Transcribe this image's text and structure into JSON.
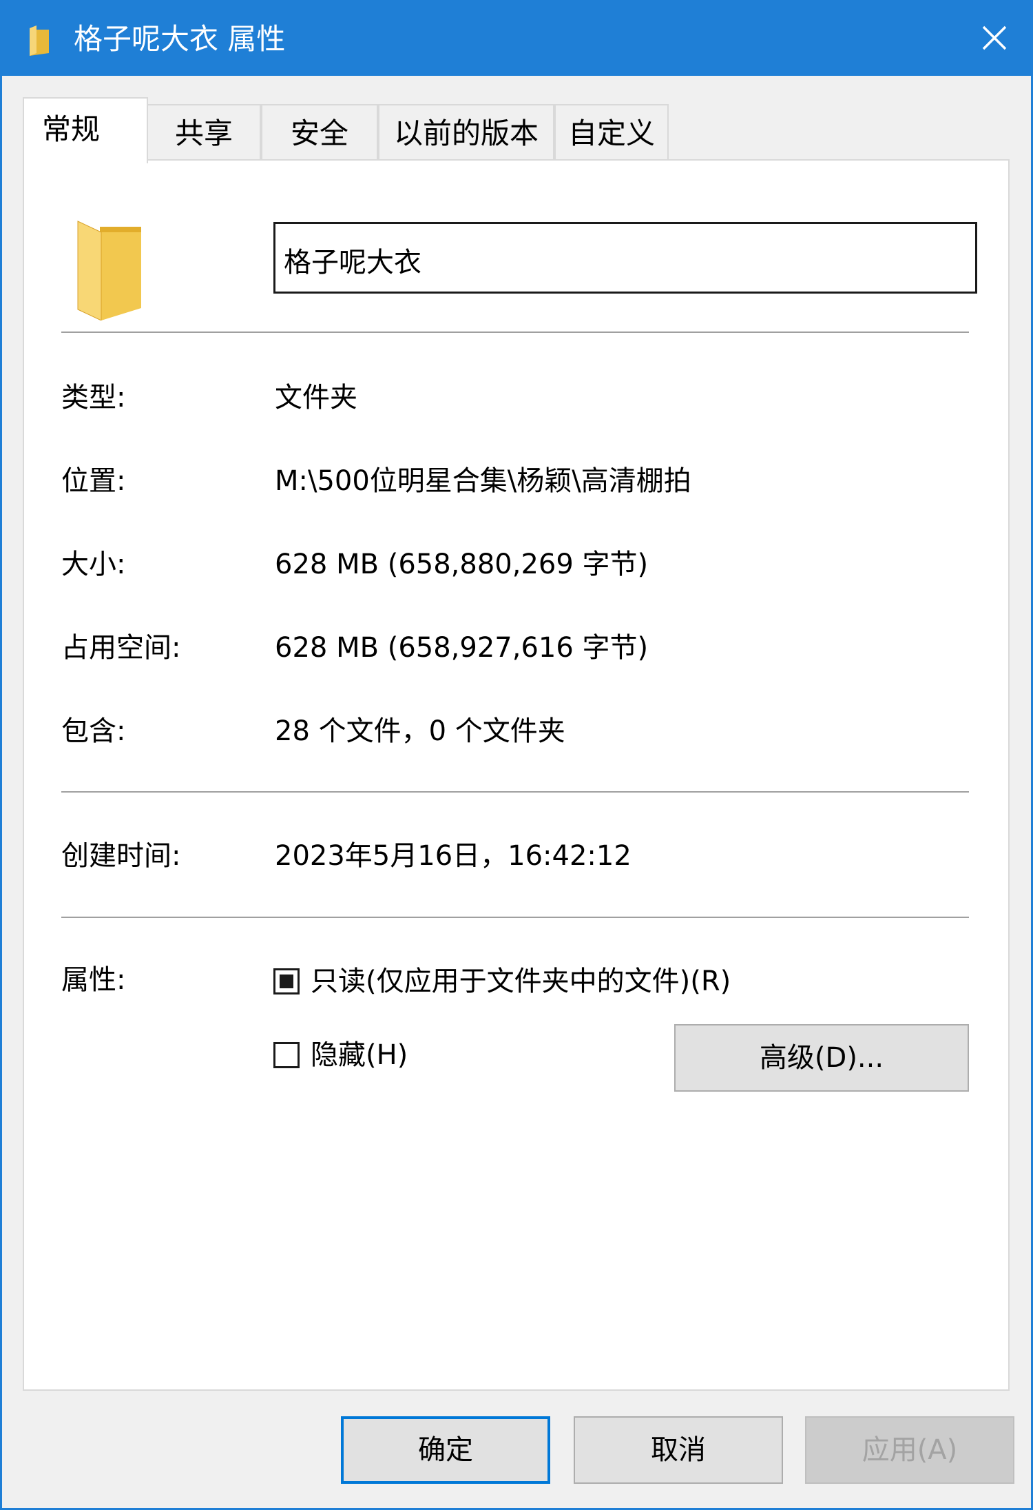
{
  "window": {
    "title": "格子呢大衣 属性",
    "accent_color": "#1f7fd6",
    "title_icon": "folder-icon",
    "close_icon": "close-icon"
  },
  "tabs": [
    {
      "label": "常规",
      "active": true
    },
    {
      "label": "共享",
      "active": false
    },
    {
      "label": "安全",
      "active": false
    },
    {
      "label": "以前的版本",
      "active": false
    },
    {
      "label": "自定义",
      "active": false
    }
  ],
  "general": {
    "folder_icon": "folder-icon",
    "name_value": "格子呢大衣",
    "rows": [
      {
        "label": "类型:",
        "value": "文件夹"
      },
      {
        "label": "位置:",
        "value": "M:\\500位明星合集\\杨颖\\高清棚拍"
      },
      {
        "label": "大小:",
        "value": "628 MB (658,880,269 字节)"
      },
      {
        "label": "占用空间:",
        "value": "628 MB (658,927,616 字节)"
      },
      {
        "label": "包含:",
        "value": "28 个文件，0 个文件夹"
      }
    ],
    "created": {
      "label": "创建时间:",
      "value": "2023年5月16日，16:42:12"
    },
    "attributes": {
      "label": "属性:",
      "readonly": {
        "label": "只读(仅应用于文件夹中的文件)(R)",
        "state": "indeterminate"
      },
      "hidden": {
        "label": "隐藏(H)",
        "checked": false
      },
      "advanced_button": "高级(D)..."
    }
  },
  "buttons": {
    "ok": "确定",
    "cancel": "取消",
    "apply": "应用(A)"
  }
}
